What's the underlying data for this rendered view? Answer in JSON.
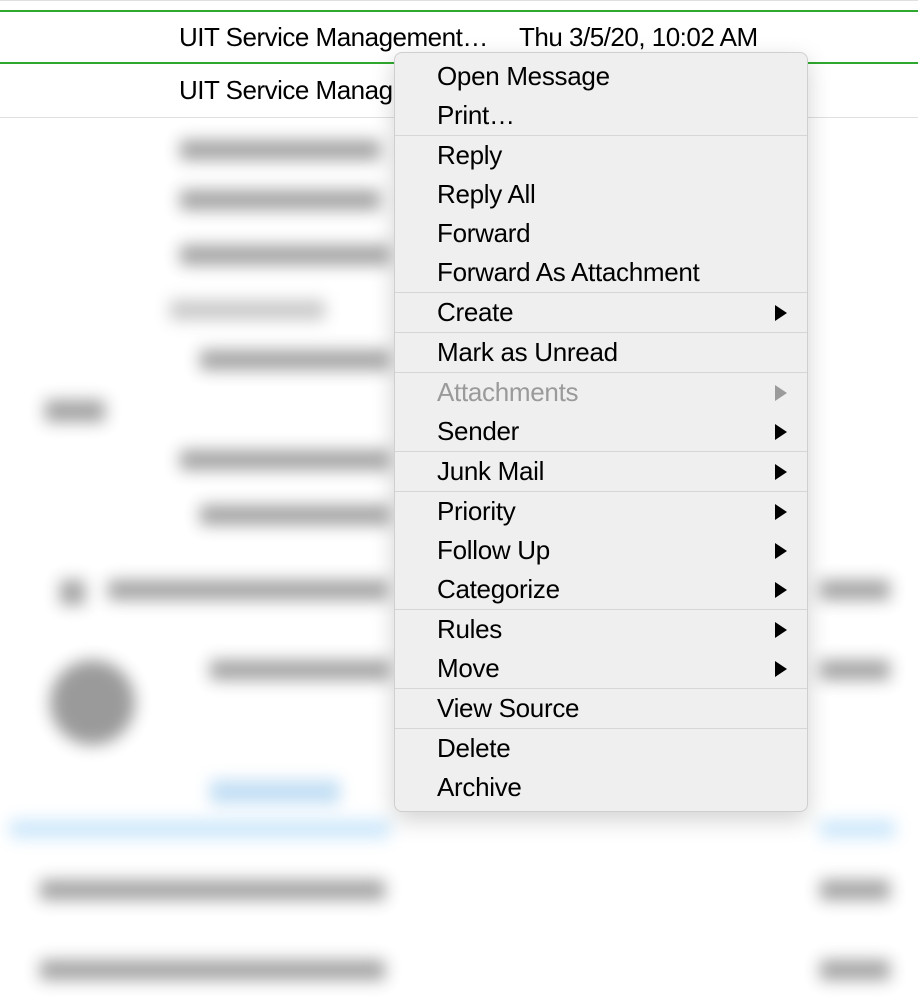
{
  "messages": [
    {
      "sender": "UIT Service Management…",
      "timestamp": "Thu 3/5/20, 10:02 AM"
    },
    {
      "sender": "UIT Service Manag",
      "timestamp": ""
    }
  ],
  "context_menu": {
    "groups": [
      {
        "items": [
          {
            "label": "Open Message",
            "submenu": false,
            "disabled": false,
            "name": "open-message"
          },
          {
            "label": "Print…",
            "submenu": false,
            "disabled": false,
            "name": "print"
          }
        ]
      },
      {
        "items": [
          {
            "label": "Reply",
            "submenu": false,
            "disabled": false,
            "name": "reply"
          },
          {
            "label": "Reply All",
            "submenu": false,
            "disabled": false,
            "name": "reply-all"
          },
          {
            "label": "Forward",
            "submenu": false,
            "disabled": false,
            "name": "forward"
          },
          {
            "label": "Forward As Attachment",
            "submenu": false,
            "disabled": false,
            "name": "forward-as-attachment"
          }
        ]
      },
      {
        "items": [
          {
            "label": "Create",
            "submenu": true,
            "disabled": false,
            "name": "create"
          }
        ]
      },
      {
        "items": [
          {
            "label": "Mark as Unread",
            "submenu": false,
            "disabled": false,
            "name": "mark-as-unread"
          }
        ]
      },
      {
        "items": [
          {
            "label": "Attachments",
            "submenu": true,
            "disabled": true,
            "name": "attachments"
          },
          {
            "label": "Sender",
            "submenu": true,
            "disabled": false,
            "name": "sender"
          }
        ]
      },
      {
        "items": [
          {
            "label": "Junk Mail",
            "submenu": true,
            "disabled": false,
            "name": "junk-mail"
          }
        ]
      },
      {
        "items": [
          {
            "label": "Priority",
            "submenu": true,
            "disabled": false,
            "name": "priority"
          },
          {
            "label": "Follow Up",
            "submenu": true,
            "disabled": false,
            "name": "follow-up"
          },
          {
            "label": "Categorize",
            "submenu": true,
            "disabled": false,
            "name": "categorize"
          }
        ]
      },
      {
        "items": [
          {
            "label": "Rules",
            "submenu": true,
            "disabled": false,
            "name": "rules"
          },
          {
            "label": "Move",
            "submenu": true,
            "disabled": false,
            "name": "move"
          }
        ]
      },
      {
        "items": [
          {
            "label": "View Source",
            "submenu": false,
            "disabled": false,
            "name": "view-source"
          }
        ]
      },
      {
        "items": [
          {
            "label": "Delete",
            "submenu": false,
            "disabled": false,
            "name": "delete"
          },
          {
            "label": "Archive",
            "submenu": false,
            "disabled": false,
            "name": "archive"
          }
        ]
      }
    ]
  }
}
